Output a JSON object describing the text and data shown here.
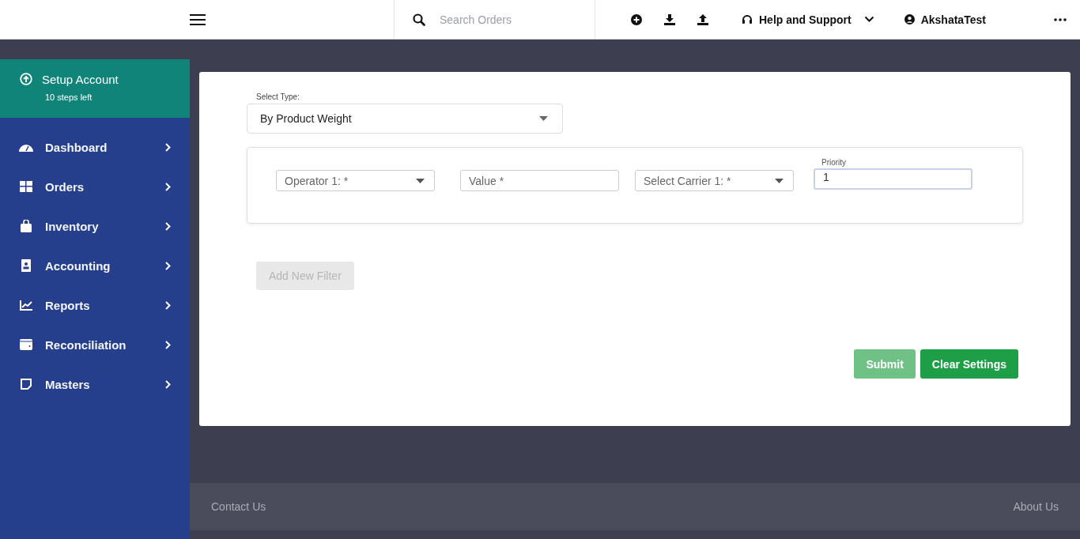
{
  "header": {
    "search": {
      "placeholder": "Search Orders"
    },
    "help": {
      "label": "Help and Support"
    },
    "user": {
      "name": "AkshataTest"
    }
  },
  "sidebar": {
    "setup": {
      "title": "Setup Account",
      "subtitle": "10 steps left"
    },
    "items": [
      {
        "label": "Dashboard"
      },
      {
        "label": "Orders"
      },
      {
        "label": "Inventory"
      },
      {
        "label": "Accounting"
      },
      {
        "label": "Reports"
      },
      {
        "label": "Reconciliation"
      },
      {
        "label": "Masters"
      }
    ]
  },
  "form": {
    "select_type": {
      "label": "Select Type:",
      "value": "By Product Weight"
    },
    "filter_fields": [
      {
        "kind": "select",
        "placeholder": "Operator 1: *"
      },
      {
        "kind": "input",
        "placeholder": "Value *"
      },
      {
        "kind": "select",
        "placeholder": "Select Carrier 1: *"
      },
      {
        "kind": "input",
        "label": "Priority",
        "value": "1",
        "focused": true
      }
    ],
    "add_filter": {
      "label": "Add New Filter",
      "disabled": true
    },
    "buttons": [
      {
        "label": "Submit",
        "disabled": true
      },
      {
        "label": "Clear Settings",
        "disabled": false
      }
    ]
  },
  "footer": {
    "left": "Contact Us",
    "right": "About Us"
  }
}
